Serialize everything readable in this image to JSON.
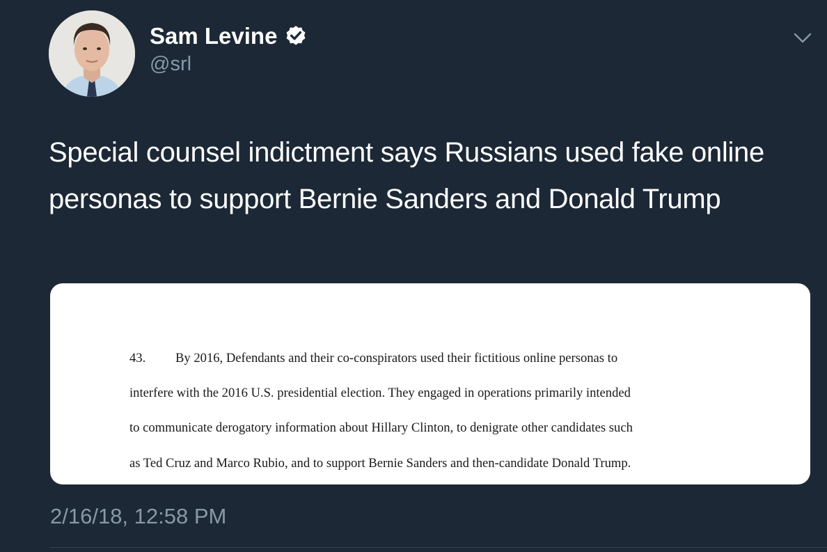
{
  "user": {
    "display_name": "Sam Levine",
    "handle": "@srl",
    "verified": true
  },
  "tweet": {
    "text": "Special counsel indictment says Russians used fake online personas to support Bernie Sanders and Donald Trump",
    "timestamp": "2/16/18, 12:58 PM"
  },
  "media": {
    "paragraph_number": "43.",
    "lines": [
      "By 2016, Defendants and their co-conspirators used their fictitious online personas to",
      "interfere with the 2016 U.S. presidential election.  They engaged in operations primarily intended",
      "to communicate derogatory information about Hillary Clinton, to denigrate other candidates such",
      "as Ted Cruz and Marco Rubio, and to support Bernie Sanders and then-candidate Donald Trump."
    ]
  },
  "icons": {
    "verified": "verified-badge-icon",
    "more": "chevron-down-icon"
  },
  "colors": {
    "background": "#1c2836",
    "secondary_text": "#8899a6",
    "divider": "#38444d"
  }
}
